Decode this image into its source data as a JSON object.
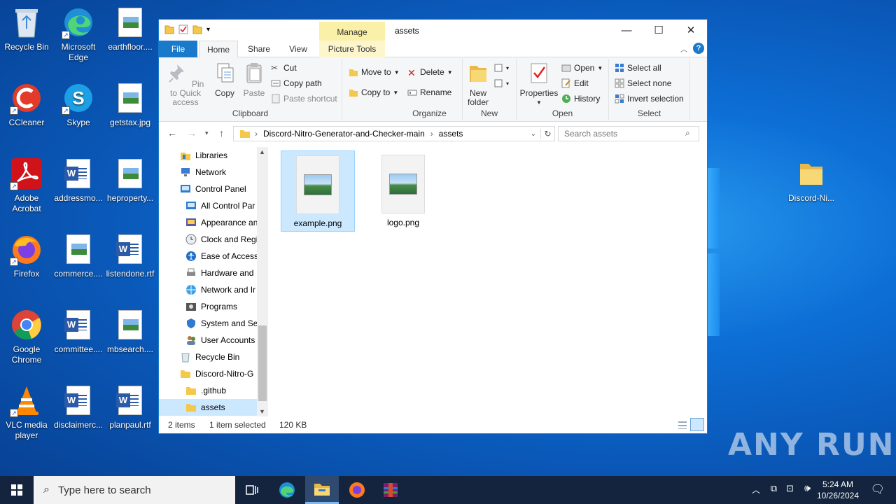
{
  "desktop": {
    "icons": [
      {
        "label": "Recycle Bin"
      },
      {
        "label": "Microsoft Edge"
      },
      {
        "label": "earthfloor...."
      },
      {
        "label": "CCleaner"
      },
      {
        "label": "Skype"
      },
      {
        "label": "getstax.jpg"
      },
      {
        "label": "Adobe Acrobat"
      },
      {
        "label": "addressmo..."
      },
      {
        "label": "hepropertу..."
      },
      {
        "label": "Firefox"
      },
      {
        "label": "commerce...."
      },
      {
        "label": "listendone.rtf"
      },
      {
        "label": "Google Chrome"
      },
      {
        "label": "committee...."
      },
      {
        "label": "mbsearch...."
      },
      {
        "label": "VLC media player"
      },
      {
        "label": "disclaimerc..."
      },
      {
        "label": "planpaul.rtf"
      },
      {
        "label": "Discord-Ni..."
      }
    ]
  },
  "window": {
    "title": "assets",
    "manage_tab": "Manage",
    "tabs": {
      "file": "File",
      "home": "Home",
      "share": "Share",
      "view": "View",
      "picture_tools": "Picture Tools"
    },
    "ribbon": {
      "clipboard": {
        "label": "Clipboard",
        "pin": "Pin to Quick access",
        "copy": "Copy",
        "paste": "Paste",
        "cut": "Cut",
        "copy_path": "Copy path",
        "paste_shortcut": "Paste shortcut"
      },
      "organize": {
        "label": "Organize",
        "move_to": "Move to",
        "copy_to": "Copy to",
        "delete": "Delete",
        "rename": "Rename"
      },
      "new": {
        "label": "New",
        "new_folder": "New folder"
      },
      "open": {
        "label": "Open",
        "properties": "Properties",
        "open": "Open",
        "edit": "Edit",
        "history": "History"
      },
      "select": {
        "label": "Select",
        "select_all": "Select all",
        "select_none": "Select none",
        "invert": "Invert selection"
      }
    },
    "address": {
      "crumbs": [
        "Discord-Nitro-Generator-and-Checker-main",
        "assets"
      ]
    },
    "search_placeholder": "Search assets",
    "nav": [
      {
        "label": "Libraries"
      },
      {
        "label": "Network"
      },
      {
        "label": "Control Panel"
      },
      {
        "label": "All Control Par"
      },
      {
        "label": "Appearance an"
      },
      {
        "label": "Clock and Regi"
      },
      {
        "label": "Ease of Access"
      },
      {
        "label": "Hardware and"
      },
      {
        "label": "Network and Ir"
      },
      {
        "label": "Programs"
      },
      {
        "label": "System and Sec"
      },
      {
        "label": "User Accounts"
      },
      {
        "label": "Recycle Bin"
      },
      {
        "label": "Discord-Nitro-G"
      },
      {
        "label": ".github"
      },
      {
        "label": "assets"
      }
    ],
    "files": [
      {
        "name": "example.png",
        "selected": true
      },
      {
        "name": "logo.png",
        "selected": false
      }
    ],
    "status": {
      "items": "2 items",
      "selected": "1 item selected",
      "size": "120 KB"
    }
  },
  "taskbar": {
    "search_placeholder": "Type here to search",
    "time": "5:24 AM",
    "date": "10/26/2024"
  },
  "watermark": "ANY RUN"
}
